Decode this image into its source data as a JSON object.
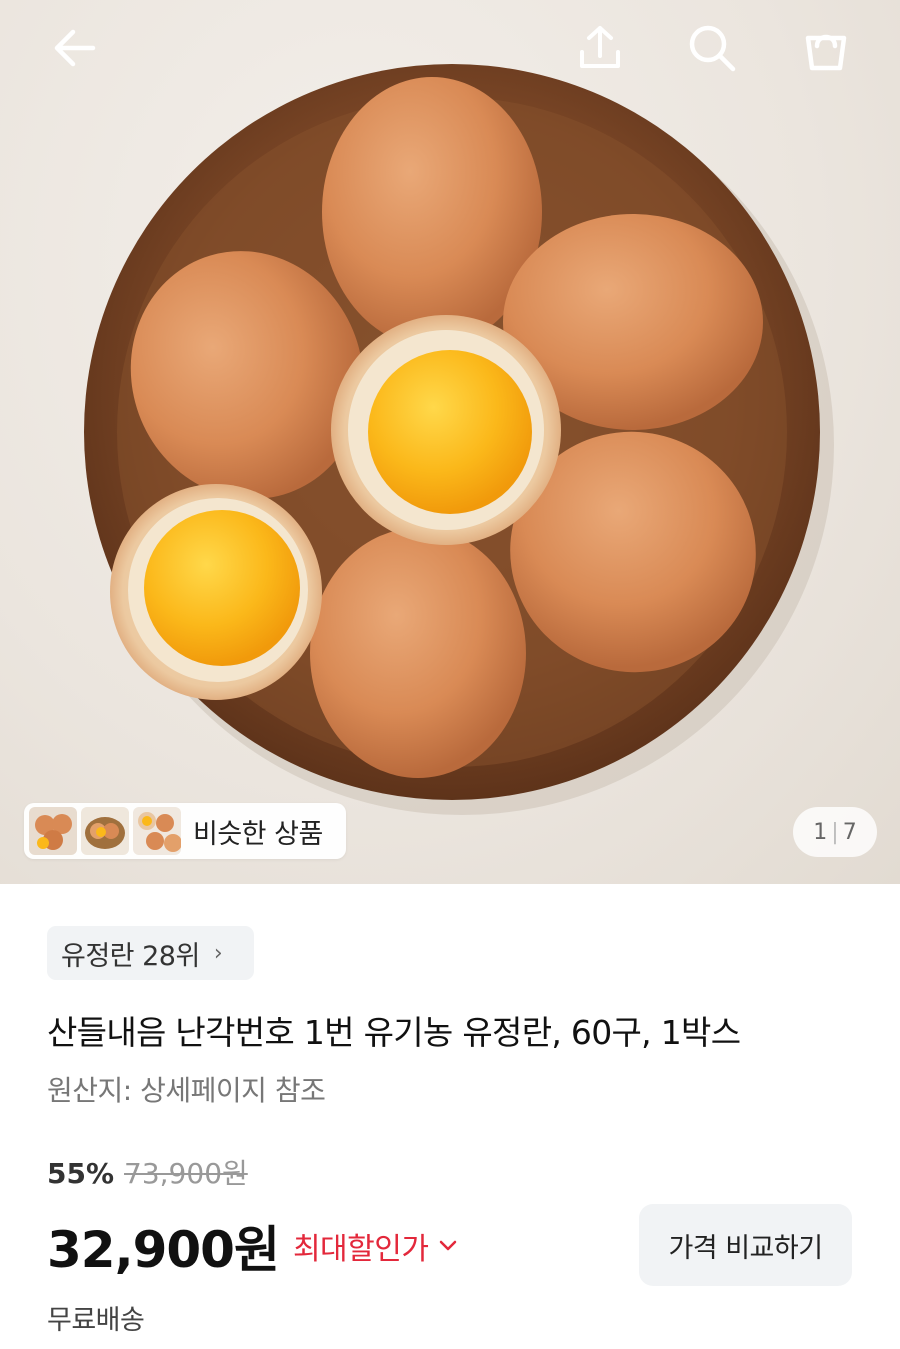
{
  "header": {
    "back_icon": "arrow-left-icon",
    "share_icon": "share-upload-icon",
    "search_icon": "search-icon",
    "cart_icon": "shopping-bag-icon"
  },
  "gallery": {
    "similar_label": "비슷한 상품",
    "page_current": "1",
    "page_total": "7"
  },
  "product": {
    "rank_label": "유정란 28위",
    "title": "산들내음 난각번호 1번 유기농 유정란, 60구, 1박스",
    "origin": "원산지: 상세페이지 참조",
    "discount_percent": "55%",
    "original_price": "73,900원",
    "price": "32,900원",
    "best_discount_label": "최대할인가",
    "compare_button": "가격 비교하기",
    "shipping": "무료배송"
  },
  "colors": {
    "accent_red": "#e3283b",
    "chip_bg": "#f1f3f5"
  }
}
